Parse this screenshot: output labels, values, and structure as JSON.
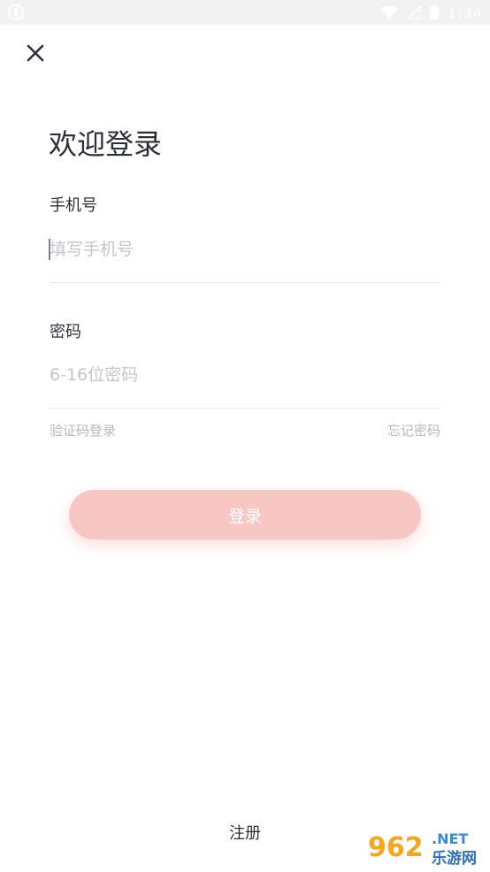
{
  "status_bar": {
    "time": "1:34",
    "icons": [
      "app-icon",
      "wifi-icon",
      "signal-icon",
      "battery-icon"
    ]
  },
  "header": {
    "close_icon": "close-icon",
    "title": "欢迎登录"
  },
  "form": {
    "phone": {
      "label": "手机号",
      "placeholder": "填写手机号",
      "value": ""
    },
    "password": {
      "label": "密码",
      "placeholder": "6-16位密码",
      "value": ""
    },
    "sms_login_link": "验证码登录",
    "forgot_password_link": "忘记密码"
  },
  "actions": {
    "login_label": "登录",
    "register_label": "注册"
  },
  "colors": {
    "login_button": "#f8c7c4",
    "text": "#2b2f3a",
    "placeholder": "#c2c6cc",
    "link": "#b5b9bf"
  },
  "watermark": {
    "text_top": "962",
    "text_net": ".NET",
    "text_bottom": "乐游网"
  }
}
